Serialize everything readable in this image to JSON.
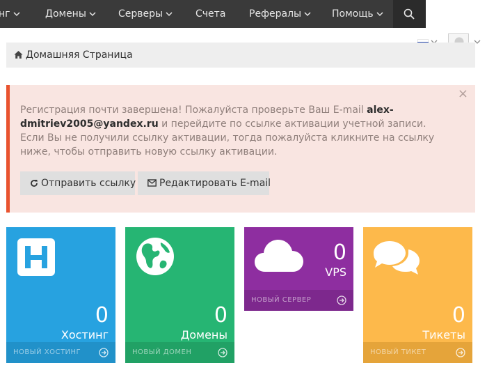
{
  "nav": {
    "items": [
      {
        "label": "нг"
      },
      {
        "label": "Домены"
      },
      {
        "label": "Серверы"
      },
      {
        "label": "Счета"
      },
      {
        "label": "Рефералы"
      },
      {
        "label": "Помощь"
      }
    ]
  },
  "breadcrumb": {
    "label": "Домашняя Страница"
  },
  "alert": {
    "text1": "Регистрация почти завершена! Пожалуйста проверьте Ваш E-mail ",
    "email1": "alex-",
    "email2": "dmitriev2005@yandex.ru",
    "text2": " и перейдите по ссылке активации учетной записи. Если Вы не получили ссылку активации, тогда пожалуйста кликните на ссылку ниже, чтобы отправить новую ссылку активации.",
    "close": "×",
    "resend_label": "Отправить ссылку",
    "edit_email_label": "Редактировать E-mail"
  },
  "tiles": [
    {
      "count": "0",
      "title": "Хостинг",
      "footer": "НОВЫЙ ХОСТИНГ",
      "color": "#27a2e0",
      "footer_color": "#2191c9"
    },
    {
      "count": "0",
      "title": "Домены",
      "footer": "НОВЫЙ ДОМЕН",
      "color": "#26b573",
      "footer_color": "#21a165"
    },
    {
      "count": "0",
      "title": "VPS",
      "footer": "НОВЫЙ СЕРВЕР",
      "color": "#8e2ea0",
      "footer_color": "#7d288d"
    },
    {
      "count": "0",
      "title": "Тикеты",
      "footer": "НОВЫЙ ТИКЕТ",
      "color": "#fdb94b",
      "footer_color": "#e5a43a"
    }
  ],
  "colors": {
    "nav_bg": "#3a3a3a",
    "alert_border": "#e9532f",
    "alert_bg": "#f9e5e1"
  }
}
